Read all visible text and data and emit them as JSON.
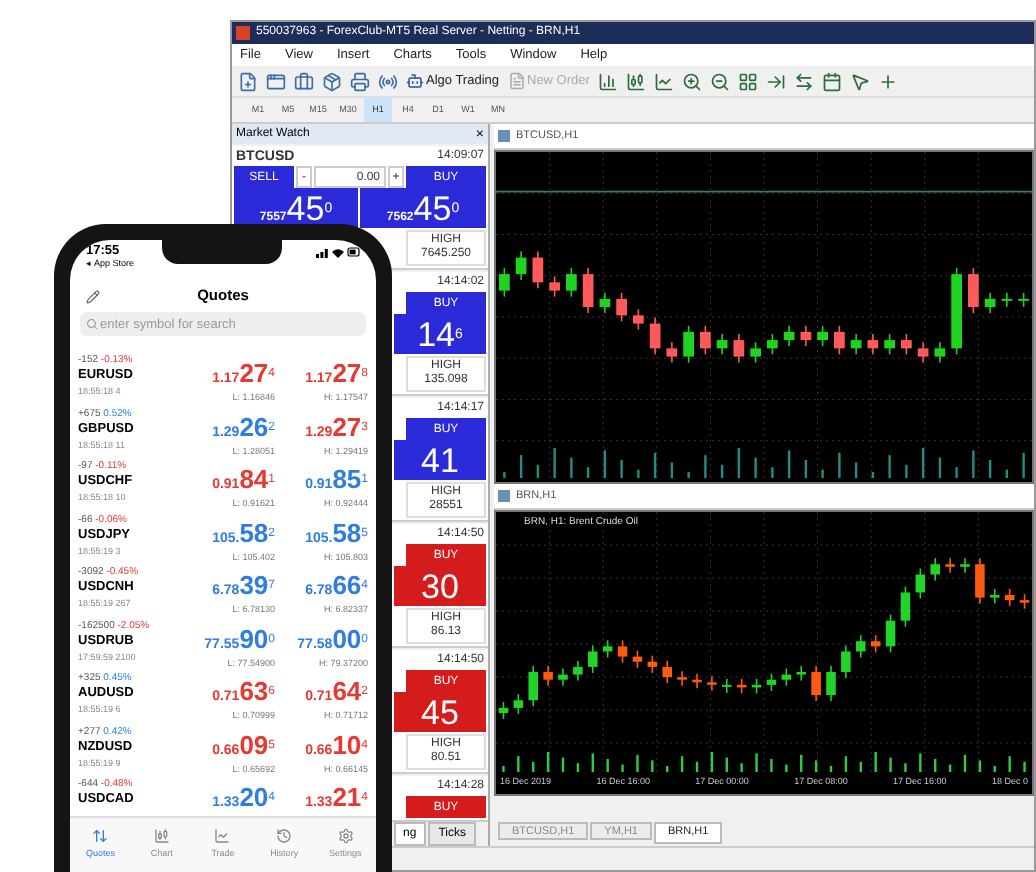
{
  "window": {
    "title": "550037963 - ForexClub-MT5 Real Server - Netting - BRN,H1"
  },
  "menu": [
    "File",
    "View",
    "Insert",
    "Charts",
    "Tools",
    "Window",
    "Help"
  ],
  "toolbar_buttons": [
    {
      "label": "Algo Trading",
      "disabled": false
    },
    {
      "label": "New Order",
      "disabled": true
    }
  ],
  "timeframes": [
    {
      "label": "M1",
      "selected": false
    },
    {
      "label": "M5",
      "selected": false
    },
    {
      "label": "M15",
      "selected": false
    },
    {
      "label": "M30",
      "selected": false
    },
    {
      "label": "H1",
      "selected": true
    },
    {
      "label": "H4",
      "selected": false
    },
    {
      "label": "D1",
      "selected": false
    },
    {
      "label": "W1",
      "selected": false
    },
    {
      "label": "MN",
      "selected": false
    }
  ],
  "market_watch": {
    "title": "Market Watch",
    "close": "×",
    "cards": [
      {
        "symbol": "BTCUSD",
        "time": "14:09:07",
        "up": true,
        "sell": "SELL",
        "volume": "0.00",
        "minus": "-",
        "plus": "+",
        "buy": "BUY",
        "sell_price": {
          "prefix": "7557",
          "big": "45",
          "sup": "0"
        },
        "buy_price": {
          "prefix": "7562",
          "big": "45",
          "sup": "0"
        },
        "high_label": "HIGH",
        "high": "7645.250"
      },
      {
        "time": "14:14:02",
        "up": true,
        "buy": "BUY",
        "buy_price": {
          "big": "14",
          "sup": "6"
        },
        "high_label": "HIGH",
        "high": "135.098"
      },
      {
        "time": "14:14:17",
        "up": true,
        "buy": "BUY",
        "buy_price": {
          "big": "41"
        },
        "high_label": "HIGH",
        "high": "28551"
      },
      {
        "time": "14:14:50",
        "up": false,
        "buy": "BUY",
        "buy_price": {
          "big": "30"
        },
        "high_label": "HIGH",
        "high": "86.13"
      },
      {
        "time": "14:14:50",
        "up": false,
        "buy": "BUY",
        "buy_price": {
          "big": "45"
        },
        "high_label": "HIGH",
        "high": "80.51"
      },
      {
        "time": "14:14:28",
        "up": false,
        "buy": "BUY"
      }
    ],
    "tabs": [
      {
        "label": "ng",
        "selected": true
      },
      {
        "label": "Ticks",
        "selected": false
      }
    ]
  },
  "charts": [
    {
      "kind": "btc",
      "title": "BTCUSD,H1"
    },
    {
      "kind": "brn",
      "title": "BRN,H1",
      "caption": "BRN, H1:  Brent Crude Oil",
      "xlabels": [
        "16 Dec 2019",
        "16 Dec 16:00",
        "17 Dec 00:00",
        "17 Dec 08:00",
        "17 Dec 16:00",
        "18 Dec 0"
      ]
    }
  ],
  "chart_tabs": [
    {
      "label": "BTCUSD,H1",
      "selected": false
    },
    {
      "label": "YM,H1",
      "selected": false
    },
    {
      "label": "BRN,H1",
      "selected": true
    }
  ],
  "phone": {
    "time": "17:55",
    "back": "◂ App Store",
    "title": "Quotes",
    "search": {
      "placeholder": "enter symbol for search"
    },
    "quotes": [
      {
        "change": "-152",
        "pct": "-0.13%",
        "pct_up": false,
        "symbol": "EURUSD",
        "time": "18:55:18",
        "spread": "4",
        "bid": {
          "prefix": "1.17",
          "big": "27",
          "sup": "4",
          "up": false
        },
        "ask": {
          "prefix": "1.17",
          "big": "27",
          "sup": "8",
          "up": false
        },
        "low": "L: 1.16846",
        "high": "H: 1.17547"
      },
      {
        "change": "+675",
        "pct": "0.52%",
        "pct_up": true,
        "symbol": "GBPUSD",
        "time": "18:55:18",
        "spread": "11",
        "bid": {
          "prefix": "1.29",
          "big": "26",
          "sup": "2",
          "up": true
        },
        "ask": {
          "prefix": "1.29",
          "big": "27",
          "sup": "3",
          "up": false
        },
        "low": "L: 1.28051",
        "high": "H: 1.29419"
      },
      {
        "change": "-97",
        "pct": "-0.11%",
        "pct_up": false,
        "symbol": "USDCHF",
        "time": "18:55:18",
        "spread": "10",
        "bid": {
          "prefix": "0.91",
          "big": "84",
          "sup": "1",
          "up": false
        },
        "ask": {
          "prefix": "0.91",
          "big": "85",
          "sup": "1",
          "up": true
        },
        "low": "L: 0.91621",
        "high": "H: 0.92444"
      },
      {
        "change": "-66",
        "pct": "-0.06%",
        "pct_up": false,
        "symbol": "USDJPY",
        "time": "18:55:19",
        "spread": "3",
        "bid": {
          "prefix": "105.",
          "big": "58",
          "sup": "2",
          "up": true
        },
        "ask": {
          "prefix": "105.",
          "big": "58",
          "sup": "5",
          "up": true
        },
        "low": "L: 105.402",
        "high": "H: 105.803"
      },
      {
        "change": "-3092",
        "pct": "-0.45%",
        "pct_up": false,
        "symbol": "USDCNH",
        "time": "18:55:19",
        "spread": "267",
        "bid": {
          "prefix": "6.78",
          "big": "39",
          "sup": "7",
          "up": true
        },
        "ask": {
          "prefix": "6.78",
          "big": "66",
          "sup": "4",
          "up": true
        },
        "low": "L: 6.78130",
        "high": "H: 6.82337"
      },
      {
        "change": "-162500",
        "pct": "-2.05%",
        "pct_up": false,
        "symbol": "USDRUB",
        "time": "17:59:59",
        "spread": "2100",
        "bid": {
          "prefix": "77.55",
          "big": "90",
          "sup": "0",
          "up": true
        },
        "ask": {
          "prefix": "77.58",
          "big": "00",
          "sup": "0",
          "up": true
        },
        "low": "L: 77.54900",
        "high": "H: 79.37200"
      },
      {
        "change": "+325",
        "pct": "0.45%",
        "pct_up": true,
        "symbol": "AUDUSD",
        "time": "18:55:19",
        "spread": "6",
        "bid": {
          "prefix": "0.71",
          "big": "63",
          "sup": "6",
          "up": false
        },
        "ask": {
          "prefix": "0.71",
          "big": "64",
          "sup": "2",
          "up": false
        },
        "low": "L: 0.70999",
        "high": "H: 0.71712"
      },
      {
        "change": "+277",
        "pct": "0.42%",
        "pct_up": true,
        "symbol": "NZDUSD",
        "time": "18:55:19",
        "spread": "9",
        "bid": {
          "prefix": "0.66",
          "big": "09",
          "sup": "5",
          "up": false
        },
        "ask": {
          "prefix": "0.66",
          "big": "10",
          "sup": "4",
          "up": false
        },
        "low": "L: 0.65692",
        "high": "H: 0.66145"
      },
      {
        "change": "-644",
        "pct": "-0.48%",
        "pct_up": false,
        "symbol": "USDCAD",
        "bid": {
          "prefix": "1.33",
          "big": "20",
          "sup": "4",
          "up": true
        },
        "ask": {
          "prefix": "1.33",
          "big": "21",
          "sup": "4",
          "up": false
        }
      }
    ],
    "tabs": [
      {
        "label": "Quotes",
        "selected": true
      },
      {
        "label": "Chart",
        "selected": false
      },
      {
        "label": "Trade",
        "selected": false
      },
      {
        "label": "History",
        "selected": false
      },
      {
        "label": "Settings",
        "selected": false
      }
    ]
  }
}
